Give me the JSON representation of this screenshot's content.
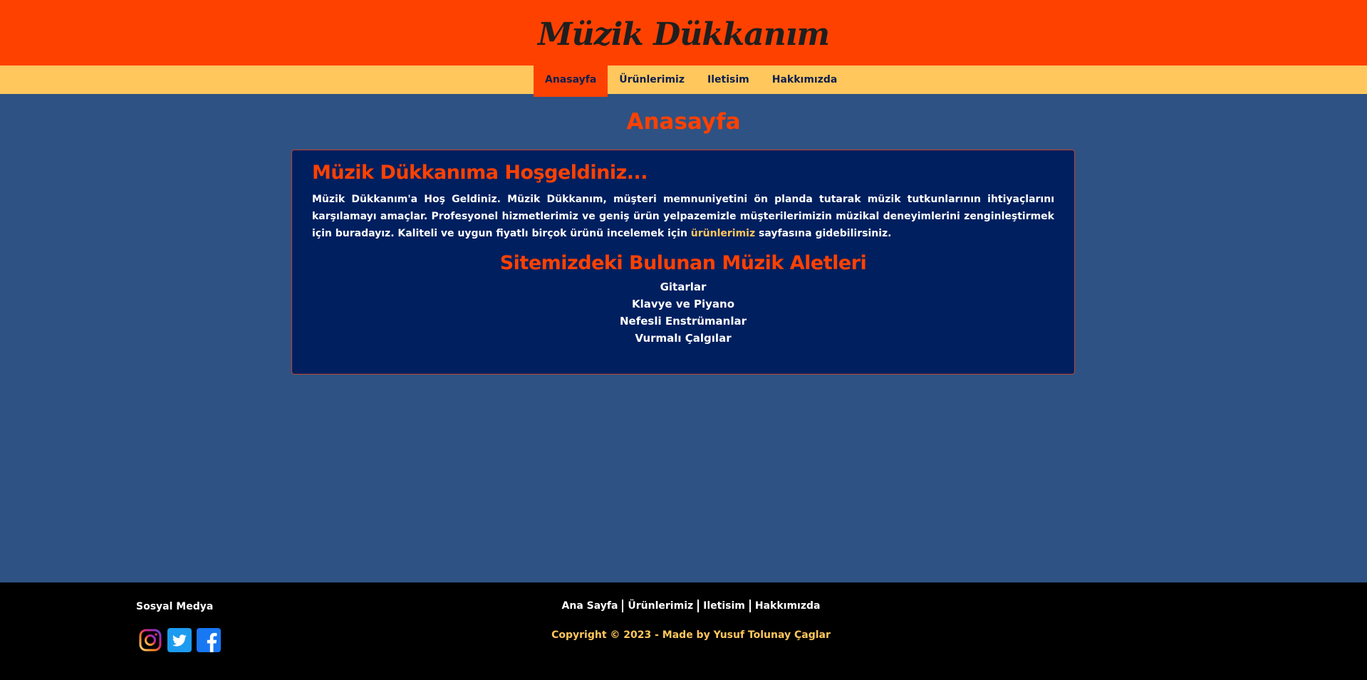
{
  "header": {
    "title": "Müzik Dükkanım"
  },
  "nav": {
    "items": [
      {
        "label": "Anasayfa",
        "active": true
      },
      {
        "label": "Ürünlerimiz",
        "active": false
      },
      {
        "label": "Iletisim",
        "active": false
      },
      {
        "label": "Hakkımızda",
        "active": false
      }
    ]
  },
  "main": {
    "page_heading": "Anasayfa",
    "welcome_title": "Müzik Dükkanıma Hoşgeldiniz...",
    "intro_before_link": "Müzik Dükkanım'a Hoş Geldiniz. Müzik Dükkanım, müşteri memnuniyetini ön planda tutarak müzik tutkunlarının ihtiyaçlarını karşılamayı amaçlar. Profesyonel hizmetlerimiz ve geniş ürün yelpazemizle müşterilerimizin müzikal deneyimlerini zenginleştirmek için buradayız. Kaliteli ve uygun fiyatlı birçok ürünü incelemek için",
    "intro_link": "ürünlerimiz",
    "intro_after_link": "sayfasına gidebilirsiniz.",
    "instruments_title": "Sitemizdeki Bulunan Müzik Aletleri",
    "instruments": [
      "Gitarlar",
      "Klavye ve Piyano",
      "Nefesli Enstrümanlar",
      "Vurmalı Çalgılar"
    ]
  },
  "footer": {
    "social_heading": "Sosyal Medya",
    "social_icons": [
      "instagram-icon",
      "twitter-icon",
      "facebook-icon"
    ],
    "links": [
      "Ana Sayfa",
      "Ürünlerimiz",
      "Iletisim",
      "Hakkımızda"
    ],
    "copyright": "Copyright © 2023 - Made by Yusuf Tolunay Çaglar"
  },
  "colors": {
    "header_bg": "#ff4100",
    "nav_bg": "#ffc75c",
    "page_bg": "#2e5283",
    "card_bg": "#001f5f",
    "accent": "#ff4100",
    "link": "#ffc75c",
    "footer_bg": "#000000"
  }
}
